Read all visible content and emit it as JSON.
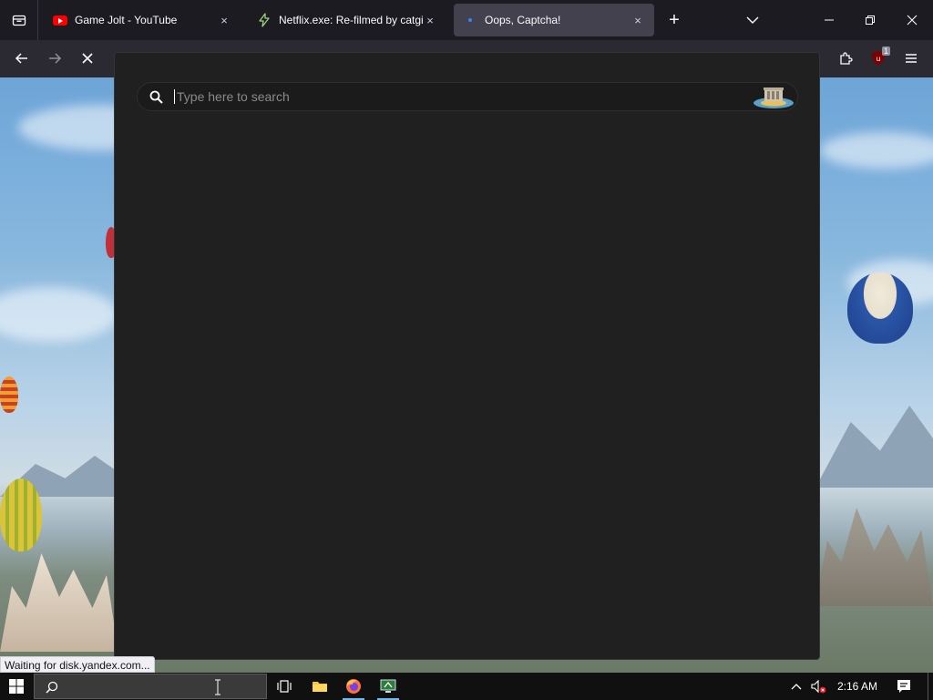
{
  "window": {
    "tabs": [
      {
        "title": "Game Jolt - YouTube",
        "favicon": "youtube-icon",
        "active": false
      },
      {
        "title": "Netflix.exe: Re-filmed by catgirl",
        "favicon": "lightning-icon",
        "active": false
      },
      {
        "title": "Oops, Captcha!",
        "favicon": "loading-dot-icon",
        "active": true
      }
    ],
    "new_tab_symbol": "+",
    "close_symbol": "×"
  },
  "navbar": {
    "extension_badge": "1"
  },
  "search": {
    "placeholder": "Type here to search"
  },
  "status": {
    "text": "Waiting for disk.yandex.com..."
  },
  "taskbar": {
    "clock": "2:16 AM"
  },
  "colors": {
    "accent": "#76b9ed",
    "tab_active": "#42414d",
    "popup_bg": "#202020"
  }
}
